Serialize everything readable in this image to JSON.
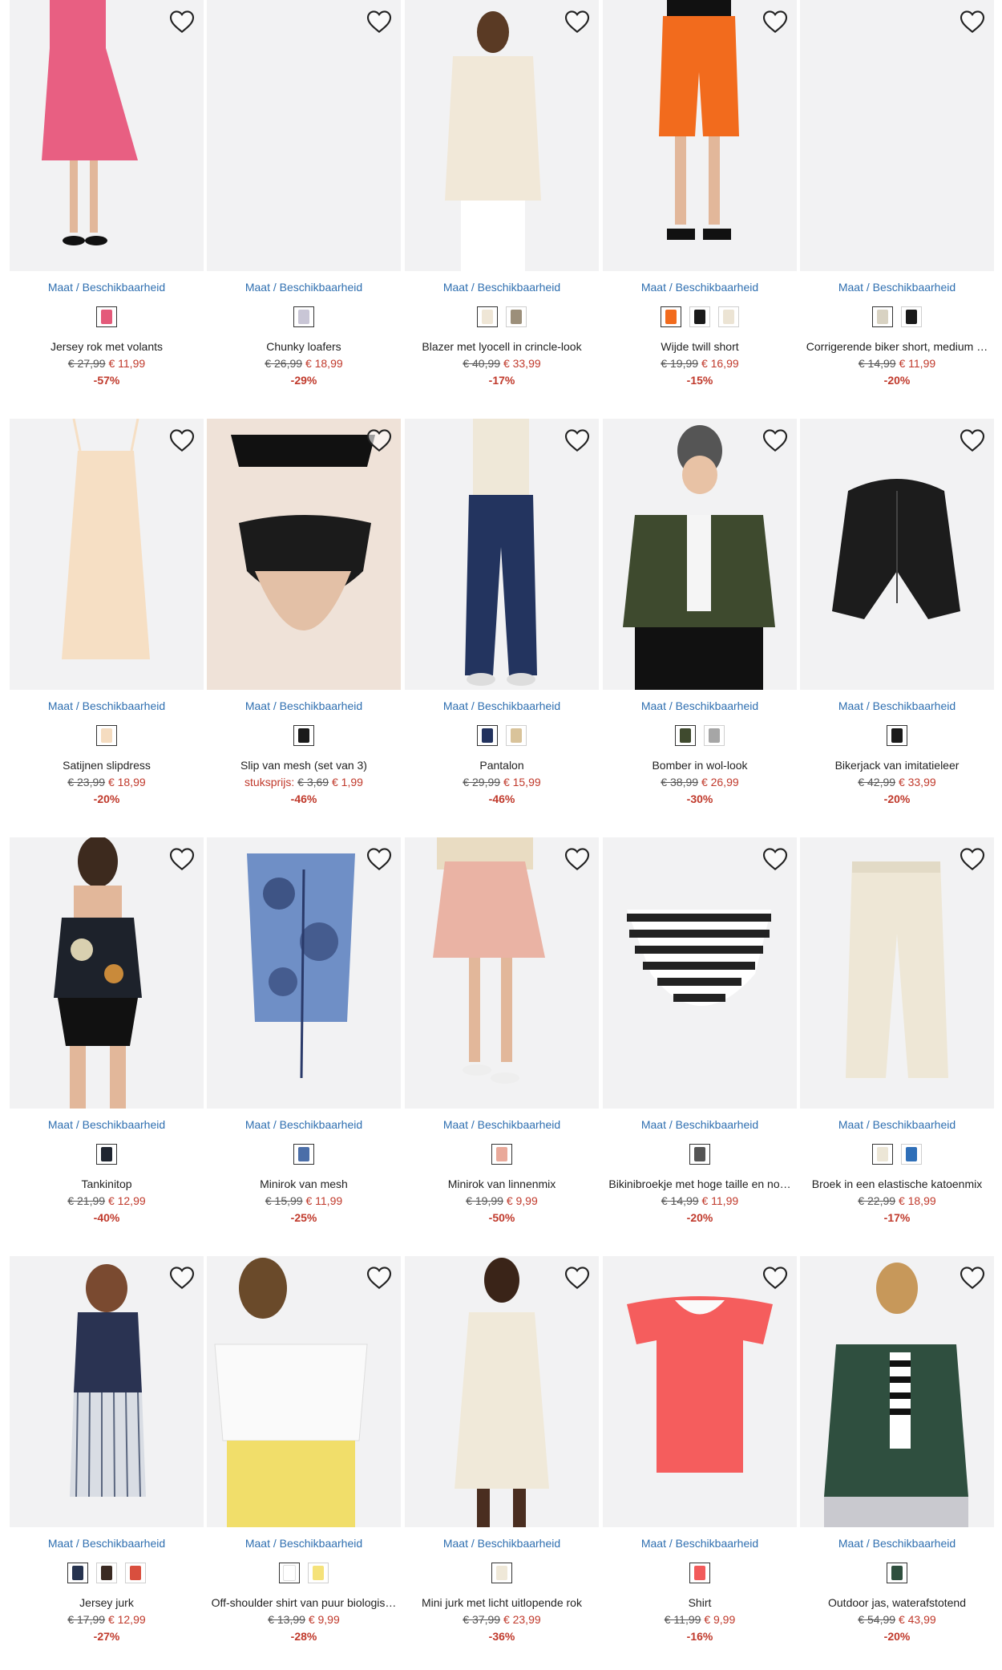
{
  "colors": {
    "link": "#2f6fb0",
    "sale": "#c0392b",
    "imageBg": "#f2f2f3"
  },
  "products": [
    {
      "maat": "Maat / Beschikbaarheid",
      "name": "Jersey rok met volants",
      "old": "€ 27,99",
      "new": "€ 11,99",
      "discount": "-57%",
      "swatches": [
        "#e45a7a"
      ],
      "img": "skirt",
      "imgColor": "#e85f82"
    },
    {
      "maat": "Maat / Beschikbaarheid",
      "name": "Chunky loafers",
      "old": "€ 26,99",
      "new": "€ 18,99",
      "discount": "-29%",
      "swatches": [
        "#c9c6d6"
      ],
      "img": "blank",
      "imgColor": "#f2f2f3"
    },
    {
      "maat": "Maat / Beschikbaarheid",
      "name": "Blazer met lyocell in crincle-look",
      "old": "€ 40,99",
      "new": "€ 33,99",
      "discount": "-17%",
      "swatches": [
        "#efe6d6",
        "#9c8f7a"
      ],
      "img": "blazer",
      "imgColor": "#f1e8d8"
    },
    {
      "maat": "Maat / Beschikbaarheid",
      "name": "Wijde twill short",
      "old": "€ 19,99",
      "new": "€ 16,99",
      "discount": "-15%",
      "swatches": [
        "#f26b1d",
        "#1a1a1a",
        "#ece4d4"
      ],
      "img": "shorts",
      "imgColor": "#f26b1d"
    },
    {
      "maat": "Maat / Beschikbaarheid",
      "name": "Corrigerende biker short, medium …",
      "old": "€ 14,99",
      "new": "€ 11,99",
      "discount": "-20%",
      "swatches": [
        "#d8d2c2",
        "#1a1a1a"
      ],
      "img": "blank",
      "imgColor": "#f2f2f3"
    },
    {
      "maat": "Maat / Beschikbaarheid",
      "name": "Satijnen slipdress",
      "old": "€ 23,99",
      "new": "€ 18,99",
      "discount": "-20%",
      "swatches": [
        "#f5dcc0"
      ],
      "img": "slipdress",
      "imgColor": "#f6dfc4"
    },
    {
      "maat": "Maat / Beschikbaarheid",
      "name": "Slip van mesh (set van 3)",
      "pre": "stuksprijs:",
      "old": "€ 3,69",
      "new": "€ 1,99",
      "discount": "-46%",
      "swatches": [
        "#1a1a1a"
      ],
      "img": "mesh",
      "imgColor": "#1b1b1b"
    },
    {
      "maat": "Maat / Beschikbaarheid",
      "name": "Pantalon",
      "old": "€ 29,99",
      "new": "€ 15,99",
      "discount": "-46%",
      "swatches": [
        "#22325e",
        "#d9c39a"
      ],
      "img": "pants",
      "imgColor": "#23345f"
    },
    {
      "maat": "Maat / Beschikbaarheid",
      "name": "Bomber in wol-look",
      "old": "€ 38,99",
      "new": "€ 26,99",
      "discount": "-30%",
      "swatches": [
        "#3f4a2e",
        "#a6a6a6"
      ],
      "img": "bomber",
      "imgColor": "#3e4a2e"
    },
    {
      "maat": "Maat / Beschikbaarheid",
      "name": "Bikerjack van imitatieleer",
      "old": "€ 42,99",
      "new": "€ 33,99",
      "discount": "-20%",
      "swatches": [
        "#1a1a1a"
      ],
      "img": "jacket",
      "imgColor": "#1c1c1c"
    },
    {
      "maat": "Maat / Beschikbaarheid",
      "name": "Tankinitop",
      "old": "€ 21,99",
      "new": "€ 12,99",
      "discount": "-40%",
      "swatches": [
        "#1f2530"
      ],
      "img": "tankini",
      "imgColor": "#1d222b"
    },
    {
      "maat": "Maat / Beschikbaarheid",
      "name": "Minirok van mesh",
      "old": "€ 15,99",
      "new": "€ 11,99",
      "discount": "-25%",
      "swatches": [
        "#4b6ea8"
      ],
      "img": "meshskirt",
      "imgColor": "#6f8fc6"
    },
    {
      "maat": "Maat / Beschikbaarheid",
      "name": "Minirok van linnenmix",
      "old": "€ 19,99",
      "new": "€ 9,99",
      "discount": "-50%",
      "swatches": [
        "#e9a99a"
      ],
      "img": "linenskirt",
      "imgColor": "#eab3a4"
    },
    {
      "maat": "Maat / Beschikbaarheid",
      "name": "Bikinibroekje met hoge taille en no…",
      "old": "€ 14,99",
      "new": "€ 11,99",
      "discount": "-20%",
      "swatches": [
        "#555555"
      ],
      "img": "bikini",
      "imgColor": "#222222"
    },
    {
      "maat": "Maat / Beschikbaarheid",
      "name": "Broek in een elastische katoenmix",
      "old": "€ 22,99",
      "new": "€ 18,99",
      "discount": "-17%",
      "swatches": [
        "#ece6d6",
        "#2f6fb8"
      ],
      "img": "cottonpants",
      "imgColor": "#eee7d6"
    },
    {
      "maat": "Maat / Beschikbaarheid",
      "name": "Jersey jurk",
      "old": "€ 17,99",
      "new": "€ 12,99",
      "discount": "-27%",
      "swatches": [
        "#26334f",
        "#3a2a22",
        "#d94f3e"
      ],
      "img": "dress",
      "imgColor": "#2a3352"
    },
    {
      "maat": "Maat / Beschikbaarheid",
      "name": "Off-shoulder shirt van puur biologis…",
      "old": "€ 13,99",
      "new": "€ 9,99",
      "discount": "-28%",
      "swatches": [
        "#ffffff",
        "#f5e27a"
      ],
      "img": "offshoulder",
      "imgColor": "#fafafa"
    },
    {
      "maat": "Maat / Beschikbaarheid",
      "name": "Mini jurk met licht uitlopende rok",
      "old": "€ 37,99",
      "new": "€ 23,99",
      "discount": "-36%",
      "swatches": [
        "#efe8d8"
      ],
      "img": "minidress",
      "imgColor": "#f0e9d9"
    },
    {
      "maat": "Maat / Beschikbaarheid",
      "name": "Shirt",
      "old": "€ 11,99",
      "new": "€ 9,99",
      "discount": "-16%",
      "swatches": [
        "#f25a5a"
      ],
      "img": "shirt",
      "imgColor": "#f55d5d"
    },
    {
      "maat": "Maat / Beschikbaarheid",
      "name": "Outdoor jas, waterafstotend",
      "old": "€ 54,99",
      "new": "€ 43,99",
      "discount": "-20%",
      "swatches": [
        "#2f4f3e"
      ],
      "img": "outdoor",
      "imgColor": "#2f4f3f"
    }
  ]
}
